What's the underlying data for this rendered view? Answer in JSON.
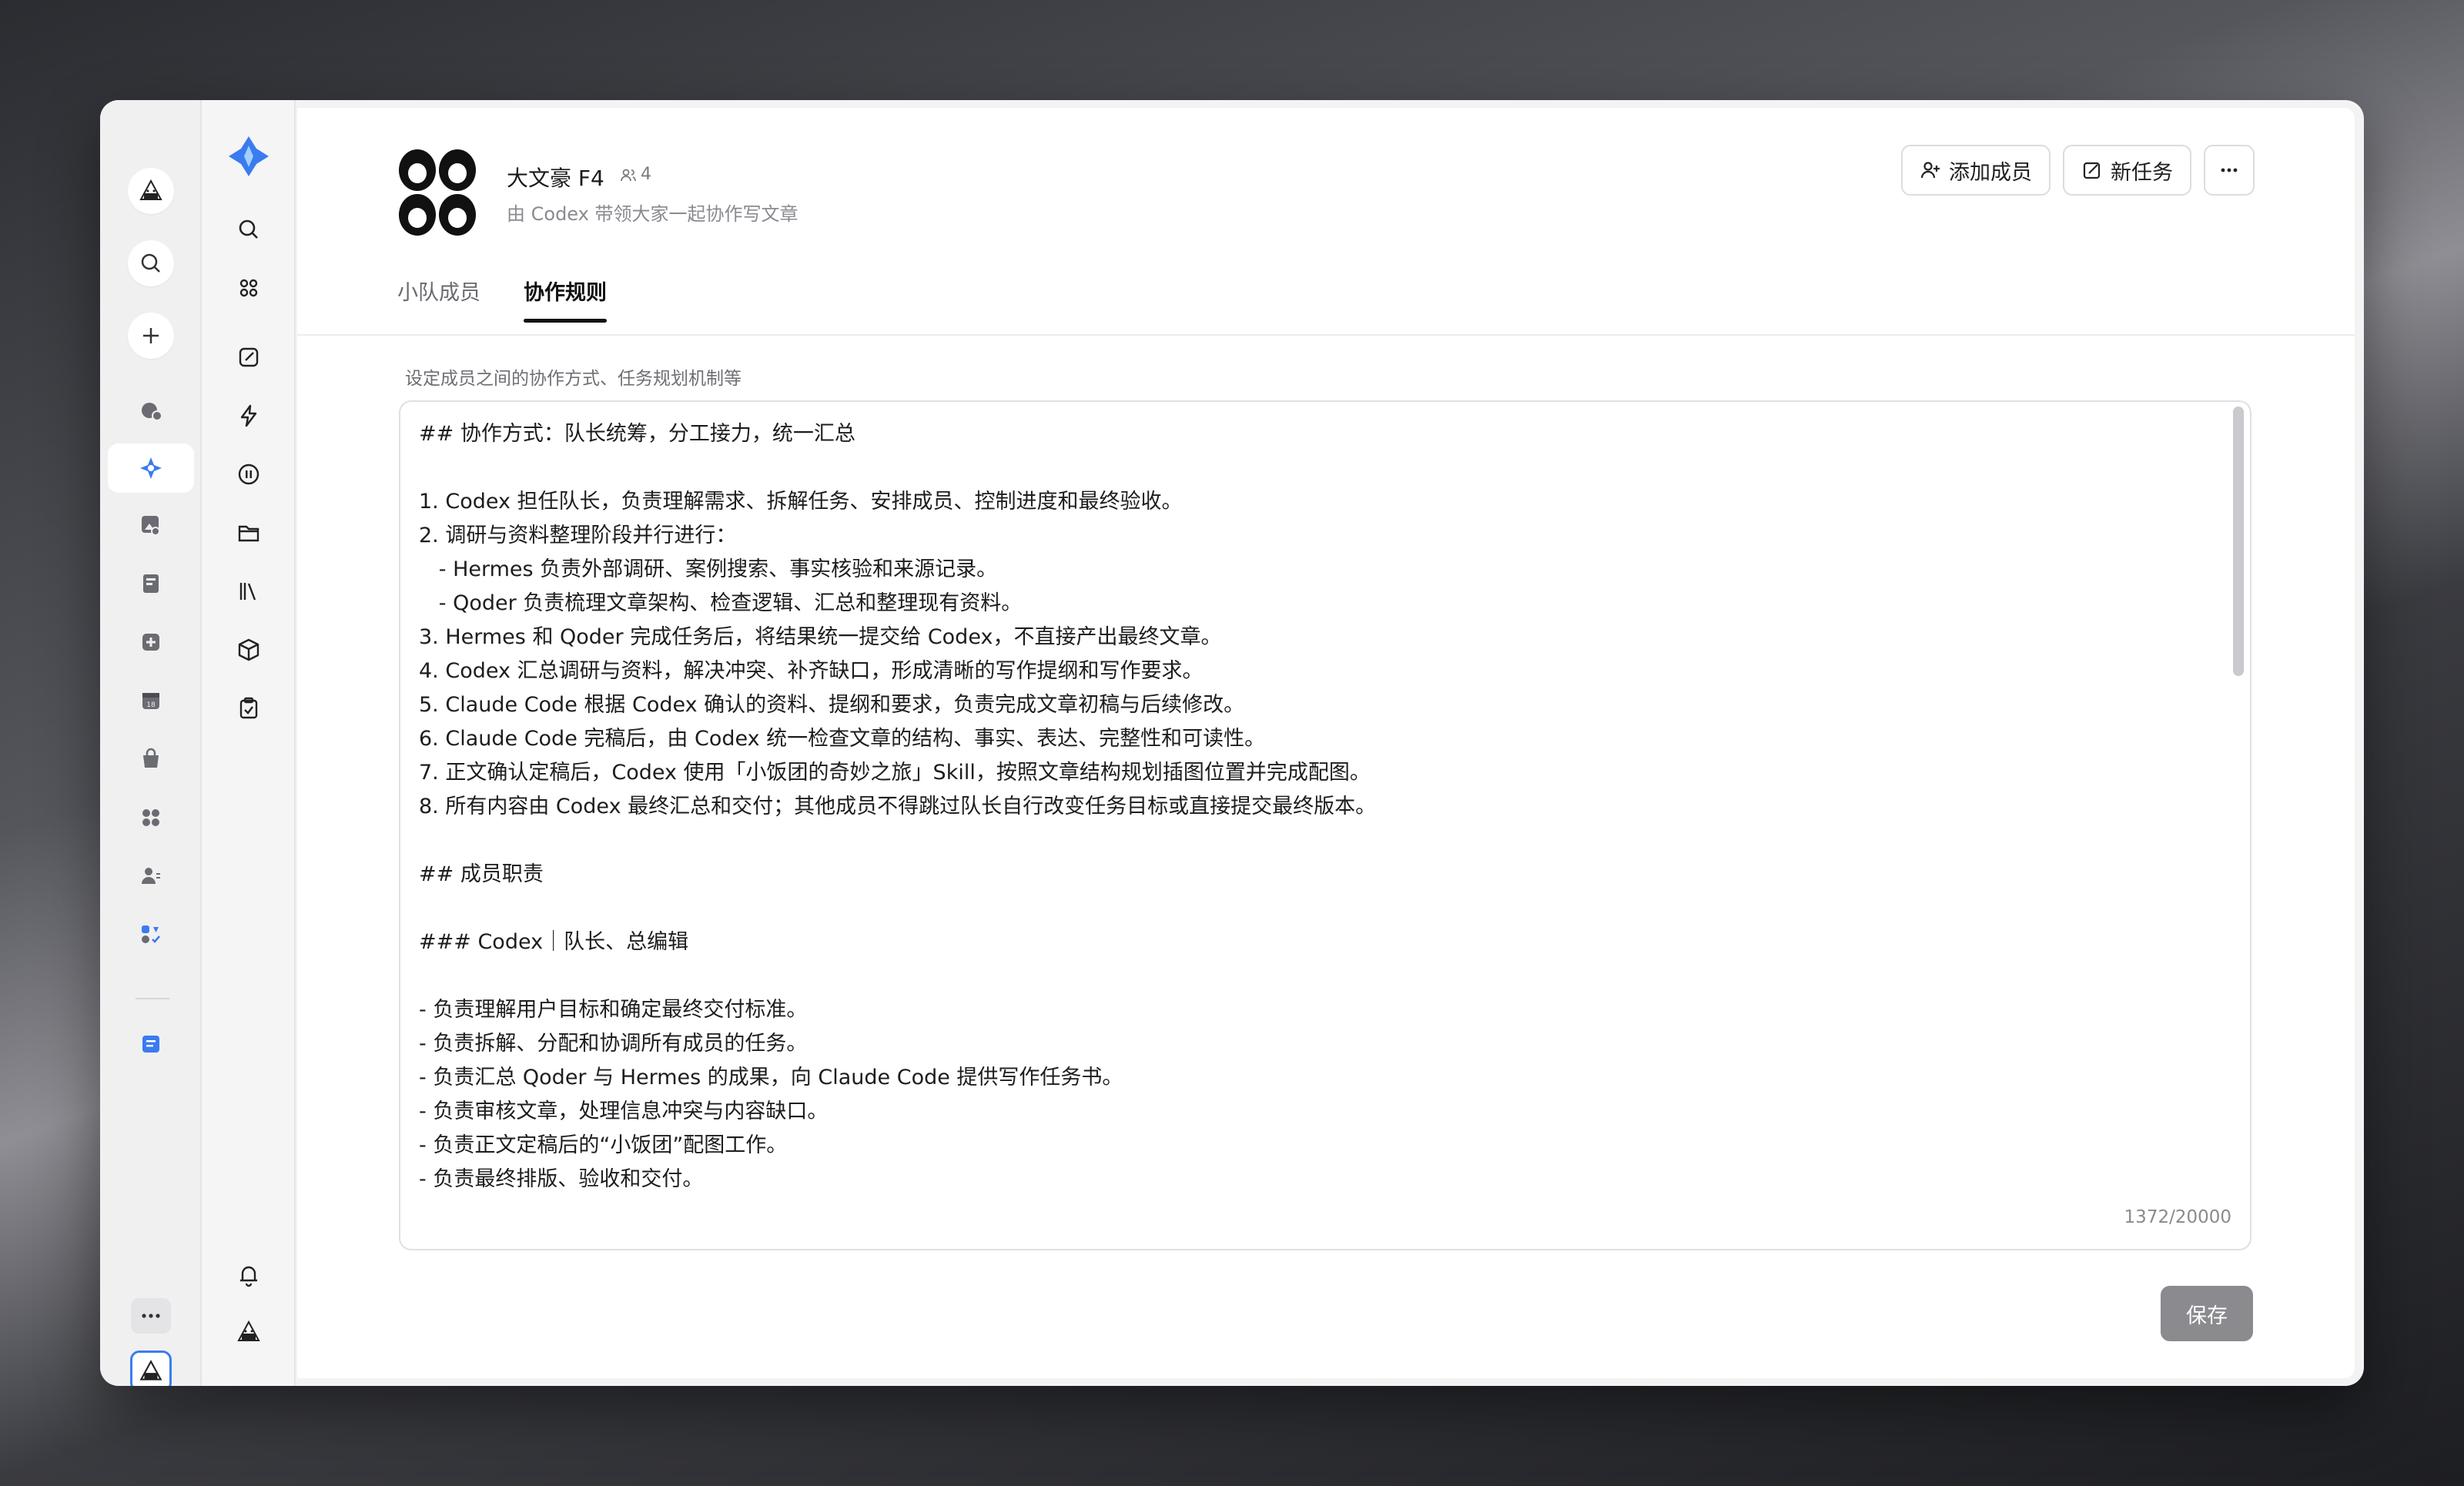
{
  "window": {
    "traffic_lights": [
      "close",
      "minimize",
      "maximize"
    ]
  },
  "left_rail": {
    "items": [
      {
        "name": "agent-avatar",
        "icon": "rice-ball-agent-icon"
      },
      {
        "name": "search",
        "icon": "search-icon"
      },
      {
        "name": "add",
        "icon": "plus-icon"
      },
      {
        "name": "chat",
        "icon": "chat-bubble-icon"
      },
      {
        "name": "team",
        "icon": "sparkle-logo-icon",
        "active": true
      },
      {
        "name": "image",
        "icon": "image-edit-icon"
      },
      {
        "name": "docs",
        "icon": "document-icon"
      },
      {
        "name": "plus-box",
        "icon": "plus-square-icon"
      },
      {
        "name": "calendar",
        "icon": "calendar-icon"
      },
      {
        "name": "shop",
        "icon": "shopping-bag-icon"
      },
      {
        "name": "apps",
        "icon": "grid-icon"
      },
      {
        "name": "contacts",
        "icon": "contacts-icon"
      },
      {
        "name": "skills",
        "icon": "badges-icon"
      },
      {
        "name": "notes",
        "icon": "note-icon"
      },
      {
        "name": "more",
        "icon": "more-icon"
      },
      {
        "name": "profile",
        "icon": "user-avatar-icon"
      }
    ]
  },
  "secondary_panel": {
    "items": [
      {
        "name": "logo",
        "icon": "app-logo-icon"
      },
      {
        "name": "search",
        "icon": "search-icon"
      },
      {
        "name": "shortcuts",
        "icon": "command-icon"
      },
      {
        "name": "compose",
        "icon": "edit-icon"
      },
      {
        "name": "automations",
        "icon": "lightning-icon"
      },
      {
        "name": "more-circle",
        "icon": "dots-circle-icon"
      },
      {
        "name": "files",
        "icon": "folder-icon"
      },
      {
        "name": "library",
        "icon": "library-icon"
      },
      {
        "name": "packages",
        "icon": "cube-icon"
      },
      {
        "name": "tasks",
        "icon": "clipboard-check-icon"
      },
      {
        "name": "notifications",
        "icon": "bell-icon"
      },
      {
        "name": "agent",
        "icon": "rice-ball-agent-icon"
      }
    ]
  },
  "team": {
    "name": "大文豪 F4",
    "member_count": "4",
    "description": "由 Codex 带领大家一起协作写文章"
  },
  "actions": {
    "add_member": "添加成员",
    "new_task": "新任务",
    "more": "more"
  },
  "tabs": [
    {
      "label": "小队成员",
      "active": false
    },
    {
      "label": "协作规则",
      "active": true
    }
  ],
  "rules": {
    "hint": "设定成员之间的协作方式、任务规划机制等",
    "lines": [
      "## 协作方式：队长统筹，分工接力，统一汇总",
      "",
      "1. Codex 担任队长，负责理解需求、拆解任务、安排成员、控制进度和最终验收。",
      "2. 调研与资料整理阶段并行进行：",
      "   - Hermes 负责外部调研、案例搜索、事实核验和来源记录。",
      "   - Qoder 负责梳理文章架构、检查逻辑、汇总和整理现有资料。",
      "3. Hermes 和 Qoder 完成任务后，将结果统一提交给 Codex，不直接产出最终文章。",
      "4. Codex 汇总调研与资料，解决冲突、补齐缺口，形成清晰的写作提纲和写作要求。",
      "5. Claude Code 根据 Codex 确认的资料、提纲和要求，负责完成文章初稿与后续修改。",
      "6. Claude Code 完稿后，由 Codex 统一检查文章的结构、事实、表达、完整性和可读性。",
      "7. 正文确认定稿后，Codex 使用「小饭团的奇妙之旅」Skill，按照文章结构规划插图位置并完成配图。",
      "8. 所有内容由 Codex 最终汇总和交付；其他成员不得跳过队长自行改变任务目标或直接提交最终版本。",
      "",
      "## 成员职责",
      "",
      "### Codex｜队长、总编辑",
      "",
      "- 负责理解用户目标和确定最终交付标准。",
      "- 负责拆解、分配和协调所有成员的任务。",
      "- 负责汇总 Qoder 与 Hermes 的成果，向 Claude Code 提供写作任务书。",
      "- 负责审核文章，处理信息冲突与内容缺口。",
      "- 负责正文定稿后的“小饭团”配图工作。",
      "- 负责最终排版、验收和交付。"
    ],
    "char_count": "1372/20000"
  },
  "footer": {
    "save_label": "保存"
  }
}
